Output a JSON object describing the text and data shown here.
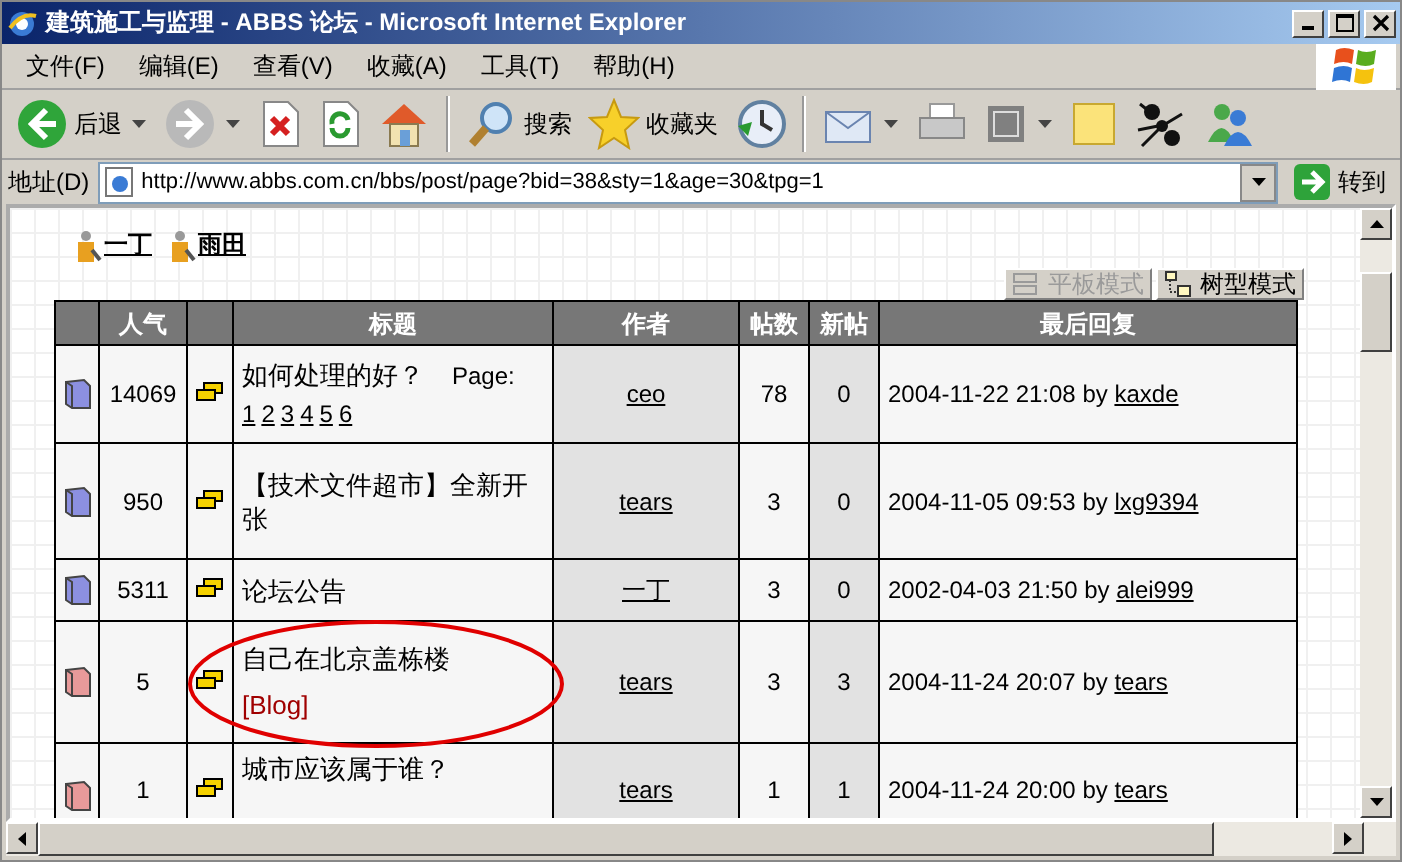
{
  "window": {
    "title": "建筑施工与监理 - ABBS 论坛 - Microsoft Internet Explorer"
  },
  "menu": [
    "文件(F)",
    "编辑(E)",
    "查看(V)",
    "收藏(A)",
    "工具(T)",
    "帮助(H)"
  ],
  "toolbar_groups": [
    [
      {
        "kind": "back",
        "label": "后退",
        "dropdown": true
      },
      {
        "kind": "forward",
        "dropdown": true
      },
      {
        "kind": "stop"
      },
      {
        "kind": "refresh"
      },
      {
        "kind": "home"
      }
    ],
    [
      {
        "kind": "search",
        "label": "搜索"
      },
      {
        "kind": "favorites",
        "label": "收藏夹"
      },
      {
        "kind": "history"
      }
    ],
    [
      {
        "kind": "mail",
        "dropdown": true
      },
      {
        "kind": "print"
      },
      {
        "kind": "edit",
        "dropdown": true
      },
      {
        "kind": "note"
      },
      {
        "kind": "ant"
      },
      {
        "kind": "messenger"
      }
    ]
  ],
  "address": {
    "label": "地址(D)",
    "url": "http://www.abbs.com.cn/bbs/post/page?bid=38&sty=1&age=30&tpg=1",
    "go": "转到"
  },
  "moderators": [
    "一丁",
    "雨田"
  ],
  "view_modes": [
    {
      "label": "平板模式",
      "selected": false
    },
    {
      "label": "树型模式",
      "selected": true
    }
  ],
  "table": {
    "columns": [
      {
        "kind": "icon"
      },
      {
        "kind": "text",
        "label": "人气"
      },
      {
        "kind": "icon"
      },
      {
        "kind": "text",
        "label": "标题"
      },
      {
        "kind": "text",
        "label": "作者"
      },
      {
        "kind": "text",
        "label": "帖数"
      },
      {
        "kind": "text",
        "label": "新帖"
      },
      {
        "kind": "text",
        "label": "最后回复"
      }
    ],
    "rows": [
      {
        "color": "#8c90e0",
        "views": "14069",
        "title": "如何处理的好？",
        "pages_label": "Page:",
        "pages": [
          "1",
          "2",
          "3",
          "4",
          "5",
          "6"
        ],
        "author": "ceo",
        "replies": "78",
        "new": "0",
        "last_reply": "2004-11-22 21:08 by",
        "last_user": "kaxde"
      },
      {
        "color": "#8c90e0",
        "views": "950",
        "title": "【技术文件超市】全新开张",
        "author": "tears",
        "replies": "3",
        "new": "0",
        "last_reply": "2004-11-05 09:53 by",
        "last_user": "lxg9394"
      },
      {
        "color": "#8c90e0",
        "views": "5311",
        "title": "论坛公告",
        "author": "一丁",
        "replies": "3",
        "new": "0",
        "last_reply": "2002-04-03 21:50 by",
        "last_user": "alei999"
      },
      {
        "color": "#e89a9a",
        "views": "5",
        "title": "自己在北京盖栋楼",
        "tag": "[Blog]",
        "circled": true,
        "author": "tears",
        "replies": "3",
        "new": "3",
        "last_reply": "2004-11-24 20:07 by",
        "last_user": "tears"
      },
      {
        "color": "#e89a9a",
        "views": "1",
        "title": "城市应该属于谁？",
        "author": "tears",
        "replies": "1",
        "new": "1",
        "last_reply": "2004-11-24 20:00 by",
        "last_user": "tears"
      }
    ]
  }
}
